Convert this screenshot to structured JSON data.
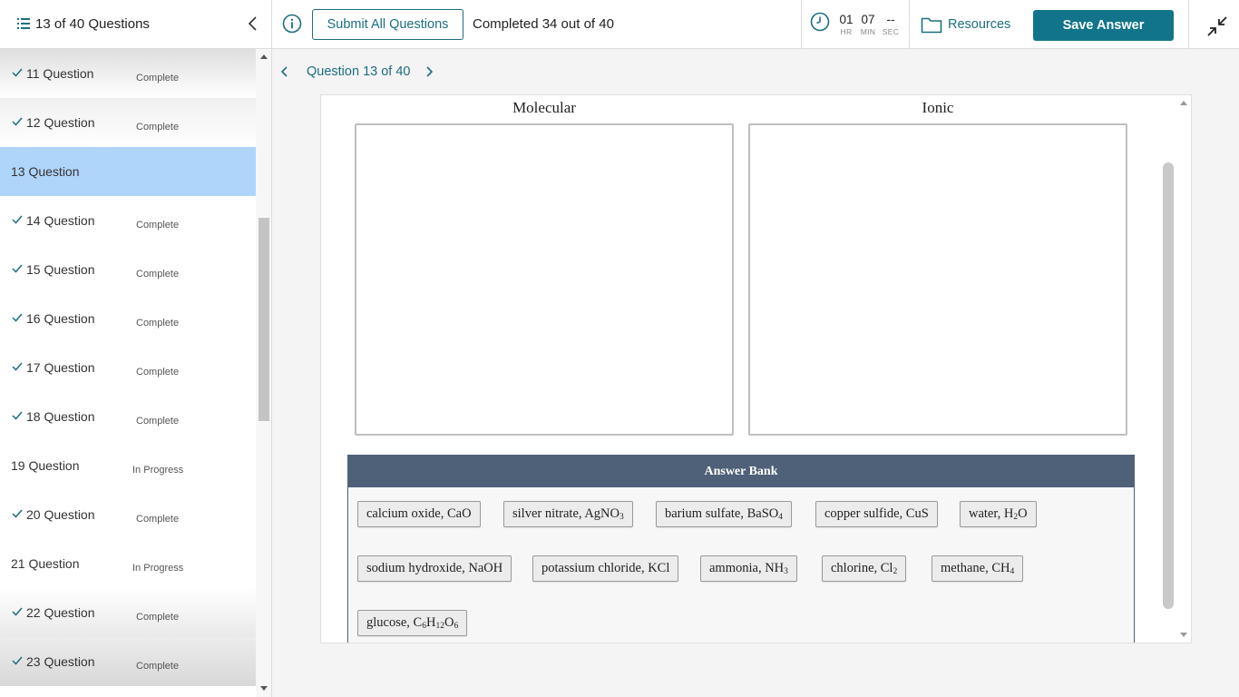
{
  "header": {
    "question_count": "13 of 40 Questions",
    "submit_label": "Submit All Questions",
    "completed_text": "Completed 34 out of 40",
    "timer": {
      "hr": "01",
      "hr_label": "HR",
      "min": "07",
      "min_label": "MIN",
      "sec": "--",
      "sec_label": "SEC"
    },
    "resources_label": "Resources",
    "save_label": "Save Answer"
  },
  "sidebar": {
    "items": [
      {
        "name": "11 Question",
        "status": "Complete",
        "checked": true
      },
      {
        "name": "12 Question",
        "status": "Complete",
        "checked": true
      },
      {
        "name": "13 Question",
        "status": "",
        "checked": false,
        "active": true
      },
      {
        "name": "14 Question",
        "status": "Complete",
        "checked": true
      },
      {
        "name": "15 Question",
        "status": "Complete",
        "checked": true
      },
      {
        "name": "16 Question",
        "status": "Complete",
        "checked": true
      },
      {
        "name": "17 Question",
        "status": "Complete",
        "checked": true
      },
      {
        "name": "18 Question",
        "status": "Complete",
        "checked": true
      },
      {
        "name": "19 Question",
        "status": "In Progress",
        "checked": false
      },
      {
        "name": "20 Question",
        "status": "Complete",
        "checked": true
      },
      {
        "name": "21 Question",
        "status": "In Progress",
        "checked": false
      },
      {
        "name": "22 Question",
        "status": "Complete",
        "checked": true
      },
      {
        "name": "23 Question",
        "status": "Complete",
        "checked": true
      }
    ]
  },
  "question_nav": {
    "label": "Question 13 of 40"
  },
  "question": {
    "columns": [
      "Molecular",
      "Ionic"
    ],
    "answer_bank_title": "Answer Bank",
    "answer_bank": [
      {
        "text": "calcium oxide, CaO",
        "html": "calcium oxide, CaO"
      },
      {
        "text": "silver nitrate, AgNO3",
        "html": "silver nitrate, AgNO<sub>3</sub>"
      },
      {
        "text": "barium sulfate, BaSO4",
        "html": "barium sulfate, BaSO<sub>4</sub>"
      },
      {
        "text": "copper sulfide, CuS",
        "html": "copper sulfide, CuS"
      },
      {
        "text": "water, H2O",
        "html": "water, H<sub>2</sub>O"
      },
      {
        "text": "sodium hydroxide, NaOH",
        "html": "sodium hydroxide, NaOH"
      },
      {
        "text": "potassium chloride, KCl",
        "html": "potassium chloride, KCl"
      },
      {
        "text": "ammonia, NH3",
        "html": "ammonia, NH<sub>3</sub>"
      },
      {
        "text": "chlorine, Cl2",
        "html": "chlorine, Cl<sub>2</sub>"
      },
      {
        "text": "methane, CH4",
        "html": "methane, CH<sub>4</sub>"
      },
      {
        "text": "glucose, C6H12O6",
        "html": "glucose, C<sub>6</sub>H<sub>12</sub>O<sub>6</sub>"
      }
    ]
  },
  "colors": {
    "accent": "#1c6e80",
    "save_button": "#12748a",
    "active_item": "#b0d5fb",
    "bank_header": "#4f6178"
  },
  "icons": {
    "list": "list-icon",
    "collapse": "chevron-left-icon",
    "info": "info-icon",
    "clock": "clock-icon",
    "folder": "folder-icon",
    "minimize": "minimize-icon",
    "check": "check-icon"
  }
}
